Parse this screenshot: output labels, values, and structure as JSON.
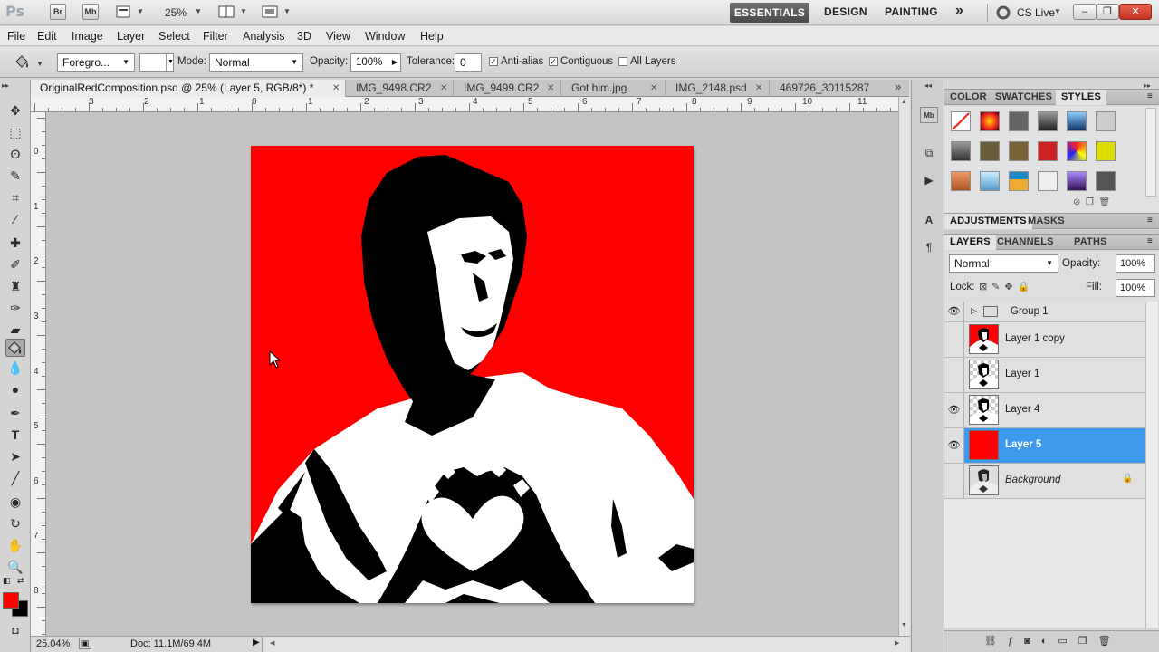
{
  "app": {
    "logo": "Ps",
    "bridge_label": "Br",
    "minibridge_label": "Mb",
    "zoom": "25%",
    "workspaces": [
      "ESSENTIALS",
      "DESIGN",
      "PAINTING"
    ],
    "more_workspaces": "»",
    "cslive": "CS Live",
    "window_buttons": [
      "‒",
      "❐",
      "✕"
    ]
  },
  "menu": [
    "File",
    "Edit",
    "Image",
    "Layer",
    "Select",
    "Filter",
    "Analysis",
    "3D",
    "View",
    "Window",
    "Help"
  ],
  "options": {
    "fill_source": "Foregro...",
    "mode_label": "Mode:",
    "mode_value": "Normal",
    "opacity_label": "Opacity:",
    "opacity_value": "100%",
    "tolerance_label": "Tolerance:",
    "tolerance_value": "0",
    "anti_alias": "Anti-alias",
    "contiguous": "Contiguous",
    "all_layers": "All Layers",
    "checked_mark": "✓"
  },
  "tabs": [
    {
      "label": "OriginalRedComposition.psd @ 25% (Layer 5, RGB/8*) *",
      "active": true
    },
    {
      "label": "IMG_9498.CR2",
      "active": false
    },
    {
      "label": "IMG_9499.CR2",
      "active": false
    },
    {
      "label": "Got him.jpg",
      "active": false
    },
    {
      "label": "IMG_2148.psd",
      "active": false
    },
    {
      "label": "469726_30115287",
      "active": false
    }
  ],
  "tabs_overflow": "»",
  "ruler": {
    "h": [
      "3",
      "2",
      "1",
      "0",
      "1",
      "2",
      "3",
      "4",
      "5",
      "6",
      "7",
      "8",
      "9",
      "10",
      "11"
    ],
    "v": [
      "0",
      "1",
      "2",
      "3",
      "4",
      "5",
      "6",
      "7",
      "8"
    ]
  },
  "status": {
    "zoom": "25.04%",
    "doc": "Doc: 11.1M/69.4M"
  },
  "colors": {
    "foreground": "#ff0000",
    "background": "#000000",
    "canvas_red": "#ff0000",
    "selection_blue": "#3d9aef"
  },
  "top_panel": {
    "tabs": [
      "COLOR",
      "SWATCHES",
      "STYLES"
    ],
    "active": "STYLES"
  },
  "adjust_panel": {
    "tabs": [
      "ADJUSTMENTS",
      "MASKS"
    ]
  },
  "layers_panel": {
    "tabs": [
      "LAYERS",
      "CHANNELS",
      "PATHS"
    ],
    "blend_mode": "Normal",
    "opacity_label": "Opacity:",
    "opacity_value": "100%",
    "lock_label": "Lock:",
    "fill_label": "Fill:",
    "fill_value": "100%",
    "layers": [
      {
        "name": "Group 1",
        "visible": true,
        "type": "group"
      },
      {
        "name": "Layer 1 copy",
        "visible": false,
        "type": "photo-red"
      },
      {
        "name": "Layer 1",
        "visible": false,
        "type": "photo-trans"
      },
      {
        "name": "Layer 4",
        "visible": true,
        "type": "photo-trans"
      },
      {
        "name": "Layer 5",
        "visible": true,
        "type": "solid-red",
        "selected": true
      },
      {
        "name": "Background",
        "visible": false,
        "type": "photo-bg",
        "locked": true
      }
    ]
  }
}
